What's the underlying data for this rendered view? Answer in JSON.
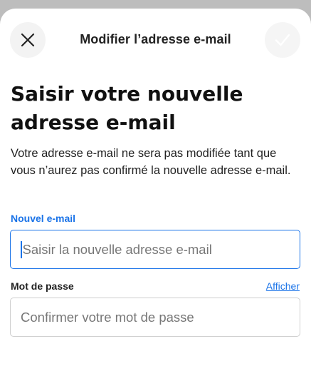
{
  "header": {
    "title": "Modifier l’adresse e-mail",
    "close_icon": "close-icon",
    "confirm_icon": "check-icon"
  },
  "page": {
    "title_line1": "Saisir votre nouvelle",
    "title_line2": "adresse e-mail",
    "description": "Votre adresse e-mail ne sera pas modifiée tant que vous n’aurez pas confirmé la nouvelle adresse e-mail."
  },
  "email_field": {
    "label": "Nouvel e-mail",
    "value": "",
    "placeholder": "Saisir la nouvelle adresse e-mail",
    "focused": true
  },
  "password_field": {
    "label": "Mot de passe",
    "value": "",
    "placeholder": "Confirmer votre mot de passe",
    "show_label": "Afficher"
  },
  "colors": {
    "accent": "#1a73e8",
    "text": "#1a1a1a",
    "backdrop": "#bdbdbd"
  }
}
